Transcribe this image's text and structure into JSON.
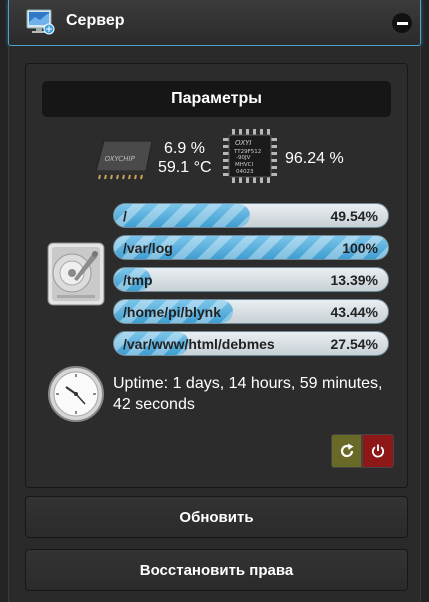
{
  "header": {
    "title": "Сервер",
    "icon": "server-monitor-icon",
    "collapse_icon": "minus-icon"
  },
  "params": {
    "title": "Параметры"
  },
  "cpu": {
    "chip_label": "OXYCHIP",
    "load": "6.9 %",
    "temperature": "59.1 °C"
  },
  "memory": {
    "chip_lines": [
      "OXYI",
      "TT29F512",
      "-90JV",
      "MHVCI",
      "04023"
    ],
    "usage": "96.24 %"
  },
  "disks": [
    {
      "label": "/",
      "value": "49.54%",
      "fill": 0.4954
    },
    {
      "label": "/var/log",
      "value": "100%",
      "fill": 1.0
    },
    {
      "label": "/tmp",
      "value": "13.39%",
      "fill": 0.1339
    },
    {
      "label": "/home/pi/blynk",
      "value": "43.44%",
      "fill": 0.4344
    },
    {
      "label": "/var/www/html/debmes",
      "value": "27.54%",
      "fill": 0.2754
    }
  ],
  "uptime": "Uptime: 1 days, 14 hours, 59 minutes, 42 seconds",
  "colors": {
    "accent": "#4aa3c9",
    "refresh_bg": "#6a6a28",
    "power_bg": "#8e1717",
    "bar_fill": "#3f9ed0"
  },
  "buttons": {
    "refresh_icon": "refresh-icon",
    "power_icon": "power-icon",
    "update": "Обновить",
    "restore": "Восстановить права"
  }
}
